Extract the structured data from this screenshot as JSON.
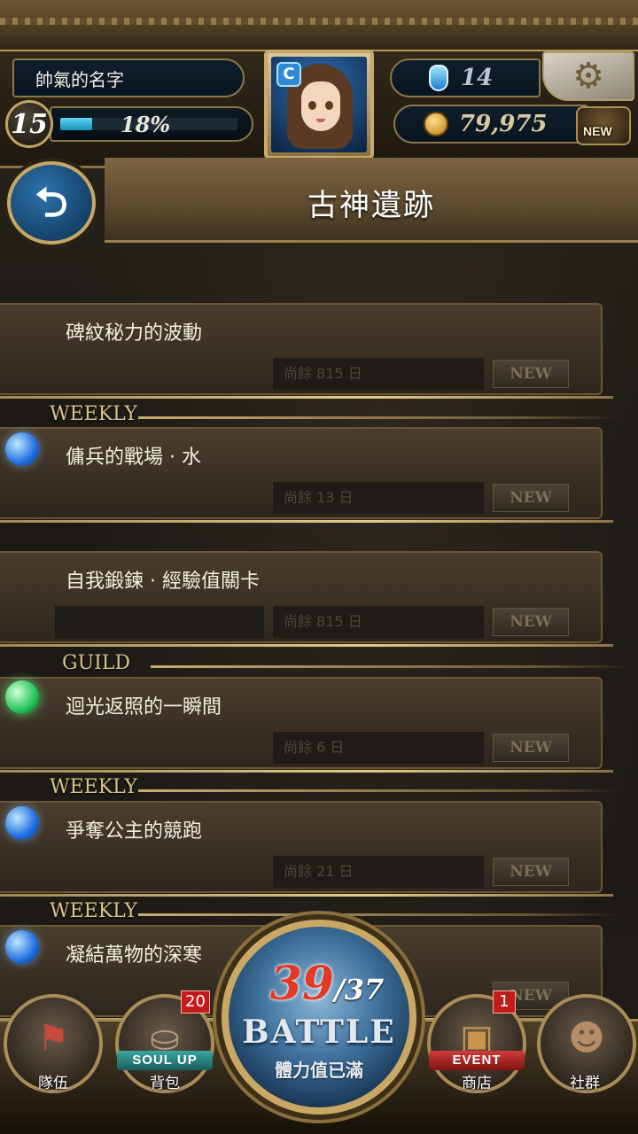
{
  "player": {
    "name": "帥氣的名字",
    "level": "15",
    "exp_percent": "18%",
    "exp_fraction": 0.18,
    "gems": "14",
    "gold": "79,975"
  },
  "hud": {
    "chest_new_label": "NEW"
  },
  "page": {
    "title": "古神遺跡"
  },
  "entries": [
    {
      "label": "碑紋秘力的波動",
      "remaining": "尚餘 815 日",
      "new_label": "NEW",
      "tag": "",
      "orb": ""
    },
    {
      "label": "傭兵的戰場 · 水",
      "remaining": "尚餘 13 日",
      "new_label": "NEW",
      "tag": "WEEKLY",
      "orb": "blue"
    },
    {
      "label": "自我鍛鍊 · 經驗值關卡",
      "remaining": "尚餘 815 日",
      "new_label": "NEW",
      "tag": "",
      "orb": ""
    },
    {
      "label": "迴光返照的一瞬間",
      "remaining": "尚餘 6 日",
      "new_label": "NEW",
      "tag": "GUILD",
      "orb": "green"
    },
    {
      "label": "爭奪公主的競跑",
      "remaining": "尚餘 21 日",
      "new_label": "NEW",
      "tag": "WEEKLY",
      "orb": "blue"
    },
    {
      "label": "凝結萬物的深寒",
      "remaining": "",
      "new_label": "NEW",
      "tag": "WEEKLY",
      "orb": "blue"
    }
  ],
  "nav": {
    "team_label": "隊伍",
    "bag_label": "背包",
    "bag_ribbon": "SOUL UP",
    "bag_badge": "20",
    "battle_current": "39",
    "battle_max": "/37",
    "battle_word": "BATTLE",
    "battle_sub": "體力值已滿",
    "shop_label": "商店",
    "shop_ribbon": "EVENT",
    "shop_badge": "1",
    "social_label": "社群"
  },
  "colors": {
    "accent_gold": "#c9a865",
    "exp_bar": "#62d6f1",
    "badge_red": "#c31a1a",
    "stamina_red": "#e33a26"
  }
}
